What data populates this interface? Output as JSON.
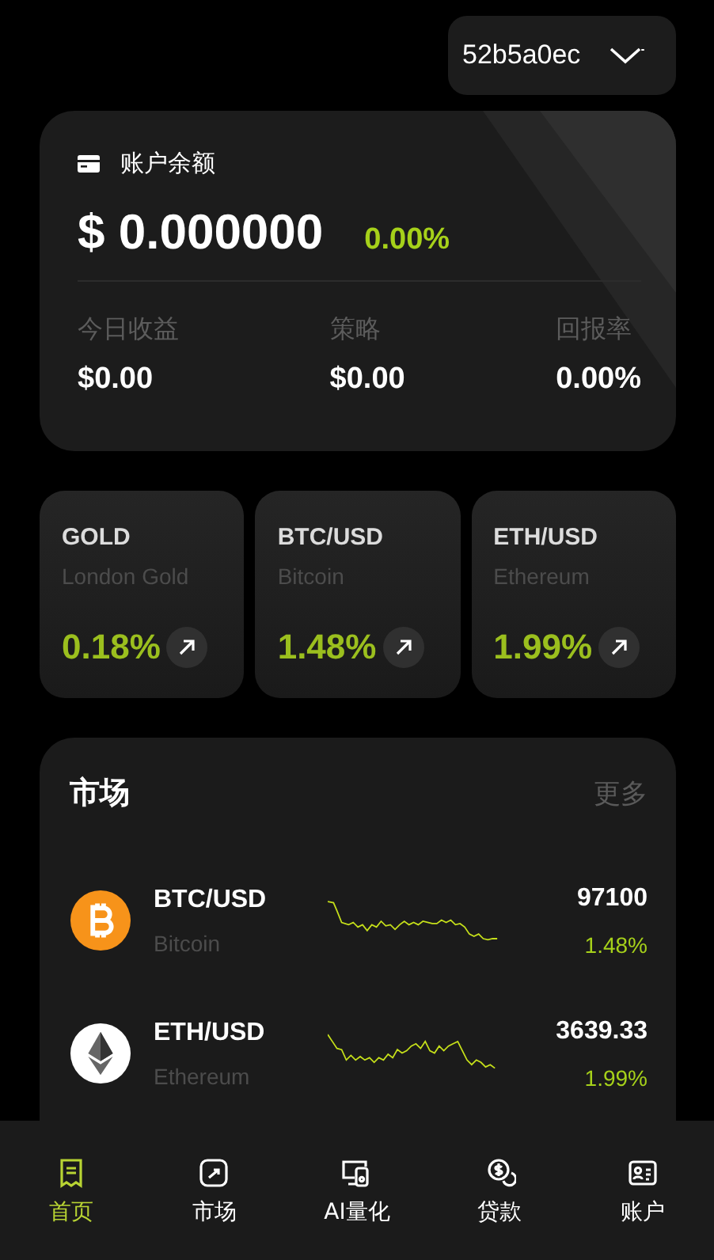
{
  "account_selector": {
    "value": "52b5a0ec"
  },
  "balance_card": {
    "title": "账户余额",
    "amount": "$ 0.000000",
    "change": "0.00%",
    "stats": [
      {
        "label": "今日收益",
        "value": "$0.00"
      },
      {
        "label": "策略",
        "value": "$0.00"
      },
      {
        "label": "回报率",
        "value": "0.00%"
      }
    ]
  },
  "tiles": [
    {
      "symbol": "GOLD",
      "name": "London Gold",
      "change": "0.18%"
    },
    {
      "symbol": "BTC/USD",
      "name": "Bitcoin",
      "change": "1.48%"
    },
    {
      "symbol": "ETH/USD",
      "name": "Ethereum",
      "change": "1.99%"
    }
  ],
  "market": {
    "title": "市场",
    "more": "更多",
    "rows": [
      {
        "symbol": "BTC/USD",
        "name": "Bitcoin",
        "price": "97100",
        "change": "1.48%"
      },
      {
        "symbol": "ETH/USD",
        "name": "Ethereum",
        "price": "3639.33",
        "change": "1.99%"
      }
    ]
  },
  "nav": [
    {
      "label": "首页",
      "selected": true
    },
    {
      "label": "市场",
      "selected": false
    },
    {
      "label": "AI量化",
      "selected": false
    },
    {
      "label": "贷款",
      "selected": false
    },
    {
      "label": "账户",
      "selected": false
    }
  ]
}
